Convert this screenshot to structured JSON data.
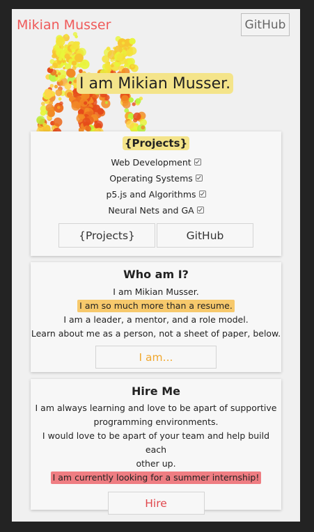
{
  "nav": {
    "brand": "Mikian Musser",
    "github_label": "GitHub"
  },
  "hero": {
    "headline": "I am Mikian Musser."
  },
  "projects_card": {
    "title": "{Projects}",
    "topics": [
      "Web Development",
      "Operating Systems",
      "p5.js and Algorithms",
      "Neural Nets and GA"
    ],
    "projects_button": "{Projects}",
    "github_button": "GitHub"
  },
  "about_card": {
    "title": "Who am I?",
    "line1": "I am Mikian Musser.",
    "highlight": "I am so much more than a resume.",
    "line3": "I am a leader, a mentor, and a role model.",
    "line4": "Learn about me as a person, not a sheet of paper, below.",
    "button": "I am...",
    "accent_color": "#f0a830"
  },
  "hire_card": {
    "title": "Hire Me",
    "line1a": "I am always learning and love to be apart of supportive",
    "line1b": "programming environments.",
    "line2a": "I would love to be apart of your team and help build each",
    "line2b": "other up.",
    "highlight": "I am currently looking for a summer internship!",
    "button": "Hire",
    "accent_color": "#e0474c"
  },
  "colors": {
    "brand": "#ef5a5a",
    "highlight_yellow": "#f4e48a",
    "highlight_orange": "#f7c96c",
    "highlight_red": "#ef7d82"
  }
}
